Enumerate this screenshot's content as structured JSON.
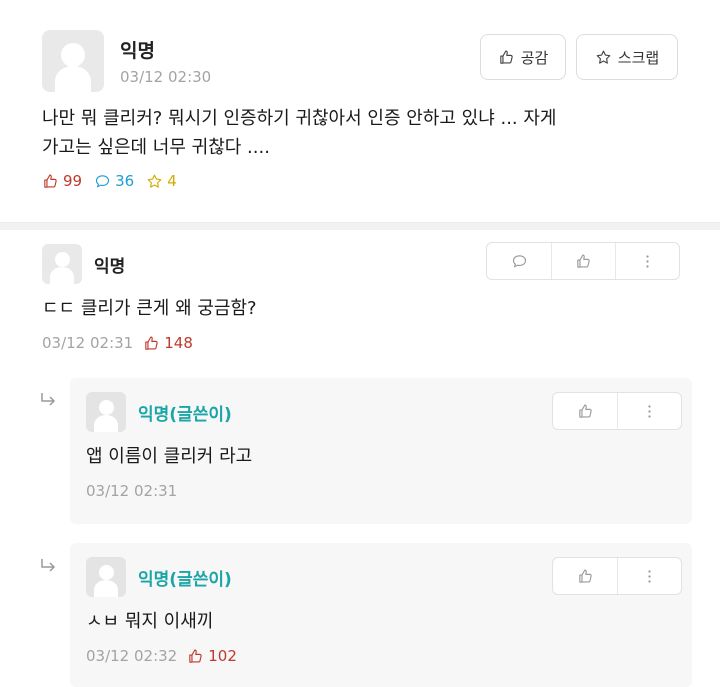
{
  "post": {
    "author": "익명",
    "time": "03/12 02:30",
    "like_button": "공감",
    "scrap_button": "스크랩",
    "text_line1": "나만 뭐 클리커? 뭐시기 인증하기 귀찮아서 인증 안하고 있냐 ... 자게",
    "text_line2": "가고는 싶은데 너무 귀찮다 ....",
    "stats": {
      "likes": "99",
      "comments": "36",
      "scraps": "4"
    }
  },
  "comment": {
    "author": "익명",
    "text": "ㄷㄷ 클리가 큰게 왜 궁금함?",
    "time": "03/12 02:31",
    "likes": "148"
  },
  "replies": [
    {
      "author": "익명(글쓴이)",
      "text": "앱 이름이 클리커 라고",
      "time": "03/12 02:31"
    },
    {
      "author": "익명(글쓴이)",
      "text": "ㅅㅂ 뭐지 이새끼",
      "time": "03/12 02:32",
      "likes": "102"
    }
  ],
  "colors": {
    "like": "#c0392b",
    "comment": "#1d9ed6",
    "scrap": "#d4a900",
    "op_author": "#1aa6a6"
  },
  "icons": [
    "thumbs-up-icon",
    "star-icon",
    "speech-bubble-icon",
    "more-vertical-icon",
    "reply-arrow-icon"
  ]
}
